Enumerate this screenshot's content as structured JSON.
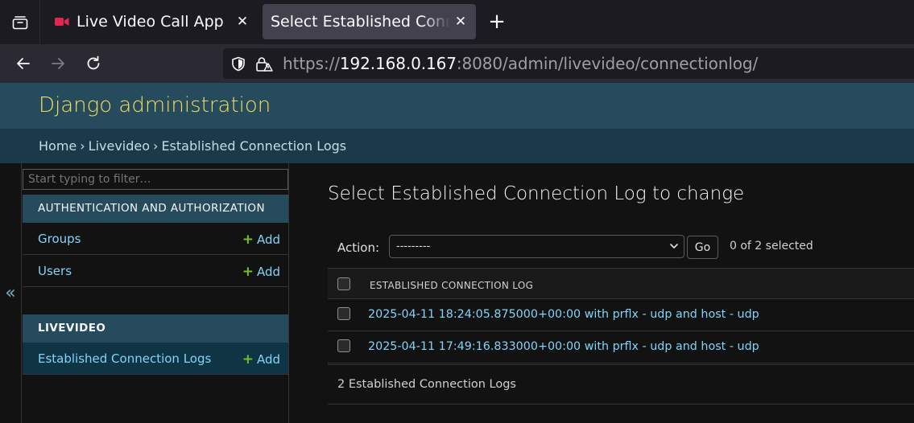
{
  "browser": {
    "tabs": [
      {
        "title": "Live Video Call App",
        "icon": "video-camera-icon",
        "icon_color": "#e22850"
      },
      {
        "title": "Select Established Connection Log to change",
        "active": true
      }
    ],
    "url": {
      "scheme": "https://",
      "host": "192.168.0.167",
      "rest": ":8080/admin/livevideo/connectionlog/"
    }
  },
  "header": {
    "site_name": "Django administration"
  },
  "breadcrumbs": {
    "home": "Home",
    "app": "Livevideo",
    "current": "Established Connection Logs"
  },
  "sidebar": {
    "filter_placeholder": "Start typing to filter…",
    "collapse_glyph": "«",
    "modules": [
      {
        "caption": "AUTHENTICATION AND AUTHORIZATION",
        "models": [
          {
            "name": "Groups",
            "add": "Add"
          },
          {
            "name": "Users",
            "add": "Add"
          }
        ]
      },
      {
        "caption": "LIVEVIDEO",
        "models": [
          {
            "name": "Established Connection Logs",
            "add": "Add",
            "current": true
          }
        ]
      }
    ]
  },
  "main": {
    "title": "Select Established Connection Log to change",
    "actions": {
      "label": "Action:",
      "selected_option": "---------",
      "go": "Go",
      "counter": "0 of 2 selected"
    },
    "table": {
      "header": "ESTABLISHED CONNECTION LOG",
      "rows": [
        "2025-04-11 18:24:05.875000+00:00 with prflx - udp and host - udp",
        "2025-04-11 17:49:16.833000+00:00 with prflx - udp and host - udp"
      ]
    },
    "paginator": "2 Established Connection Logs"
  },
  "colors": {
    "header_bg": "#264b5d",
    "breadcrumbs_bg": "#1b3a49",
    "site_name": "#f5dd5d",
    "link": "#81d4fa",
    "add_plus": "#70bf2b"
  }
}
